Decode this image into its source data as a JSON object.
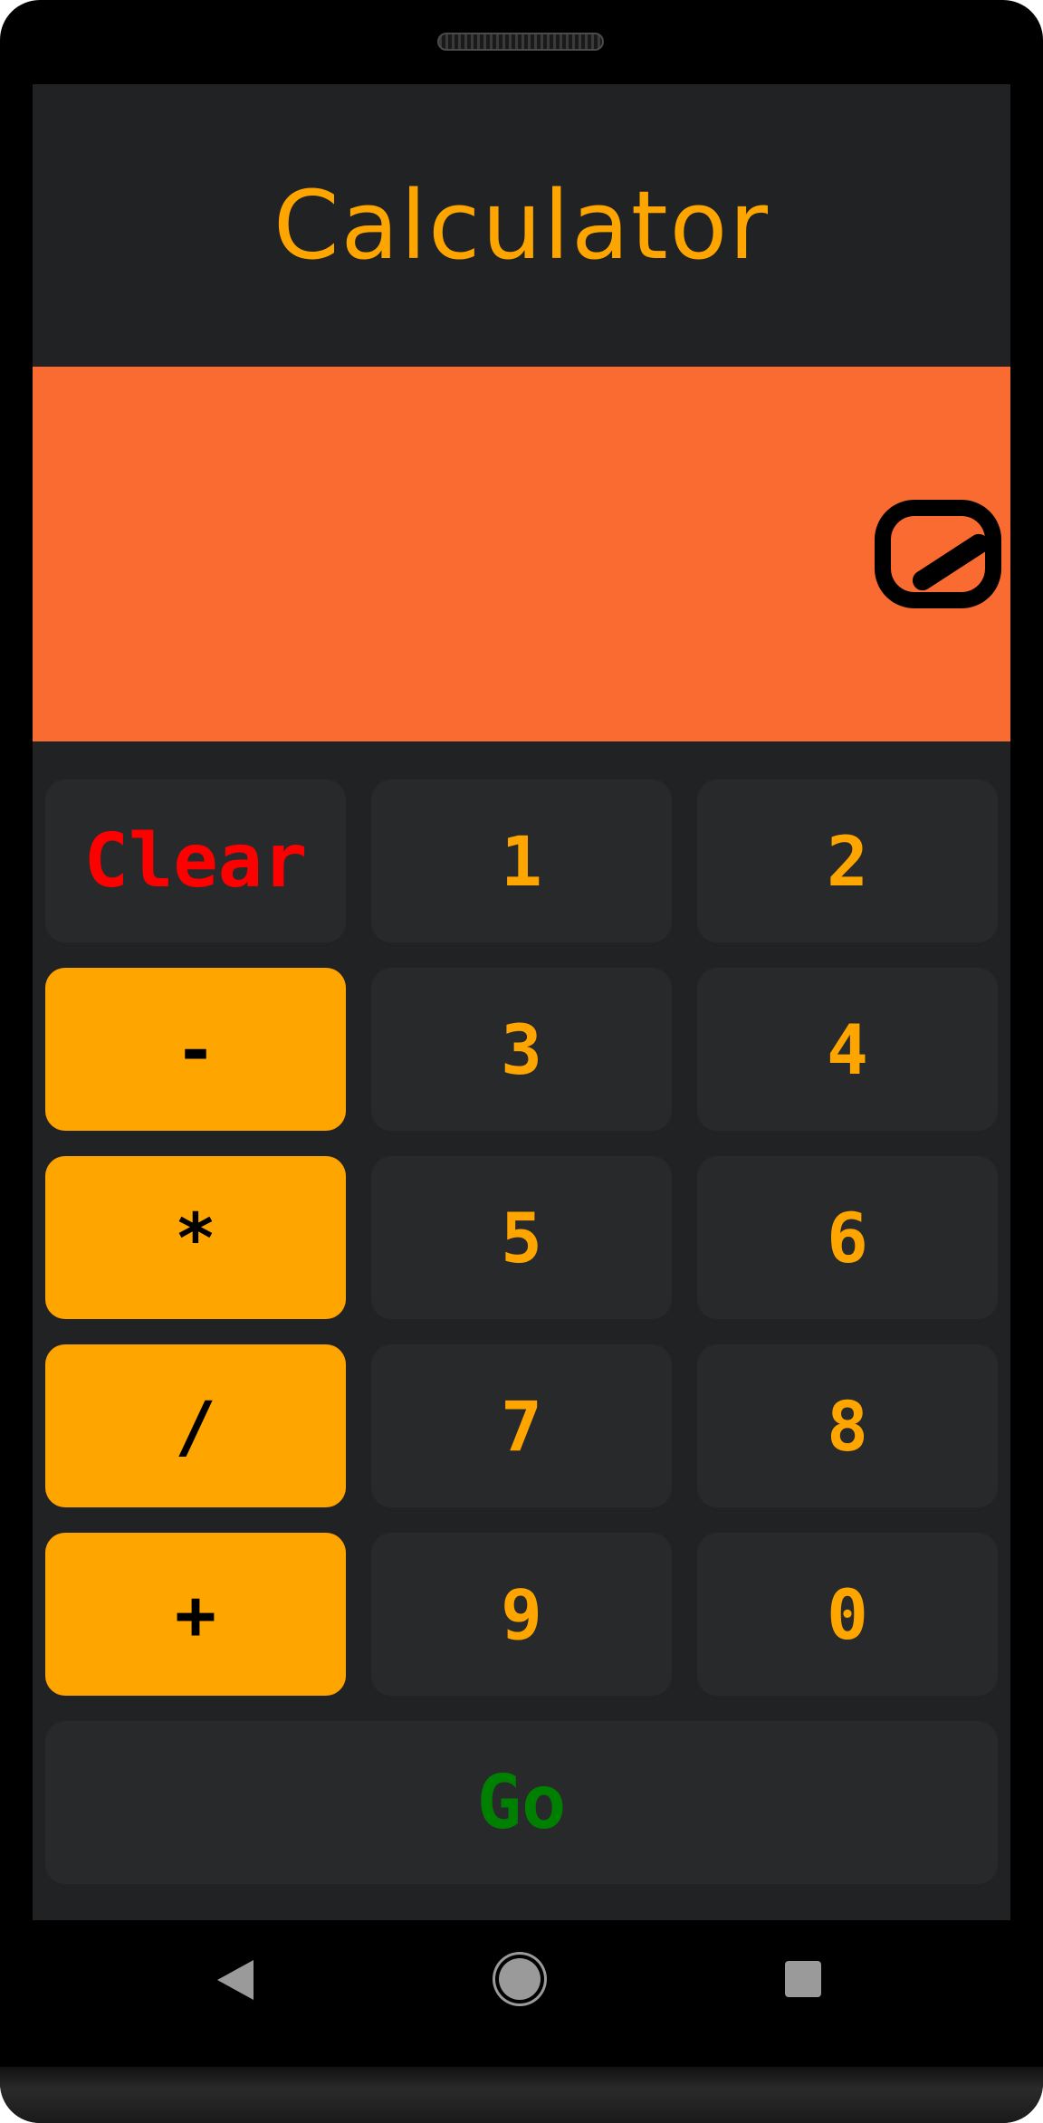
{
  "app": {
    "title": "Calculator"
  },
  "display": {
    "value": "0"
  },
  "keypad": {
    "clear": "Clear",
    "one": "1",
    "two": "2",
    "minus": "-",
    "three": "3",
    "four": "4",
    "multiply": "*",
    "five": "5",
    "six": "6",
    "divide": "/",
    "seven": "7",
    "eight": "8",
    "plus": "+",
    "nine": "9",
    "zero": "0",
    "go": "Go"
  },
  "colors": {
    "accent": "#ffa500",
    "display_background": "#f96b30",
    "clear_text": "#ff0000",
    "go_text": "#008000",
    "key_background": "#28292b",
    "screen_background": "#212224"
  },
  "navigation": {
    "icons": [
      "back-icon",
      "home-icon",
      "recent-apps-icon"
    ]
  }
}
